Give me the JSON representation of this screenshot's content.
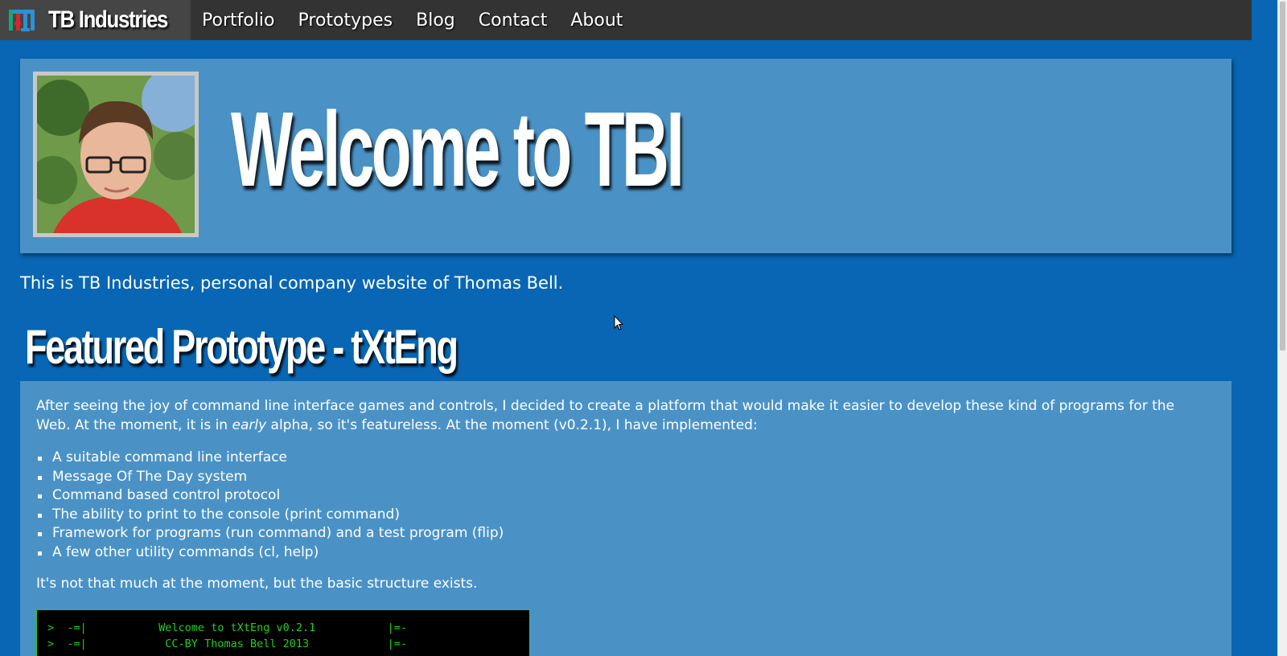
{
  "brand": {
    "name": "TB Industries",
    "logo_text": "TBI"
  },
  "nav": {
    "items": [
      {
        "label": "Portfolio"
      },
      {
        "label": "Prototypes"
      },
      {
        "label": "Blog"
      },
      {
        "label": "Contact"
      },
      {
        "label": "About"
      }
    ]
  },
  "hero": {
    "title": "Welcome to TBI",
    "avatar_alt": "Portrait photo"
  },
  "intro": "This is TB Industries, personal company website of Thomas Bell.",
  "featured": {
    "heading": "Featured Prototype - tXtEng",
    "para_before": "After seeing the joy of command line interface games and controls, I decided to create a platform that would make it easier to develop these kind of programs for the Web. At the moment, it is in ",
    "para_emph": "early",
    "para_after": " alpha, so it's featureless. At the moment (v0.2.1), I have implemented:",
    "list": [
      "A suitable command line interface",
      "Message Of The Day system",
      "Command based control protocol",
      "The ability to print to the console (print command)",
      "Framework for programs (run command) and a test program (flip)",
      "A few other utility commands (cl, help)"
    ],
    "note": "It's not that much at the moment, but the basic structure exists.",
    "console_lines": [
      ">  -=|           Welcome to tXtEng v0.2.1           |=-",
      ">  -=|            CC-BY Thomas Bell 2013            |=-"
    ]
  },
  "colors": {
    "page_bg": "#0866b4",
    "panel_bg": "#4a92c6",
    "navbar_bg": "#333333",
    "console_green": "#1ed01e"
  },
  "icons": {
    "logo": "tbi-logo-icon",
    "cursor": "mouse-pointer-icon"
  }
}
